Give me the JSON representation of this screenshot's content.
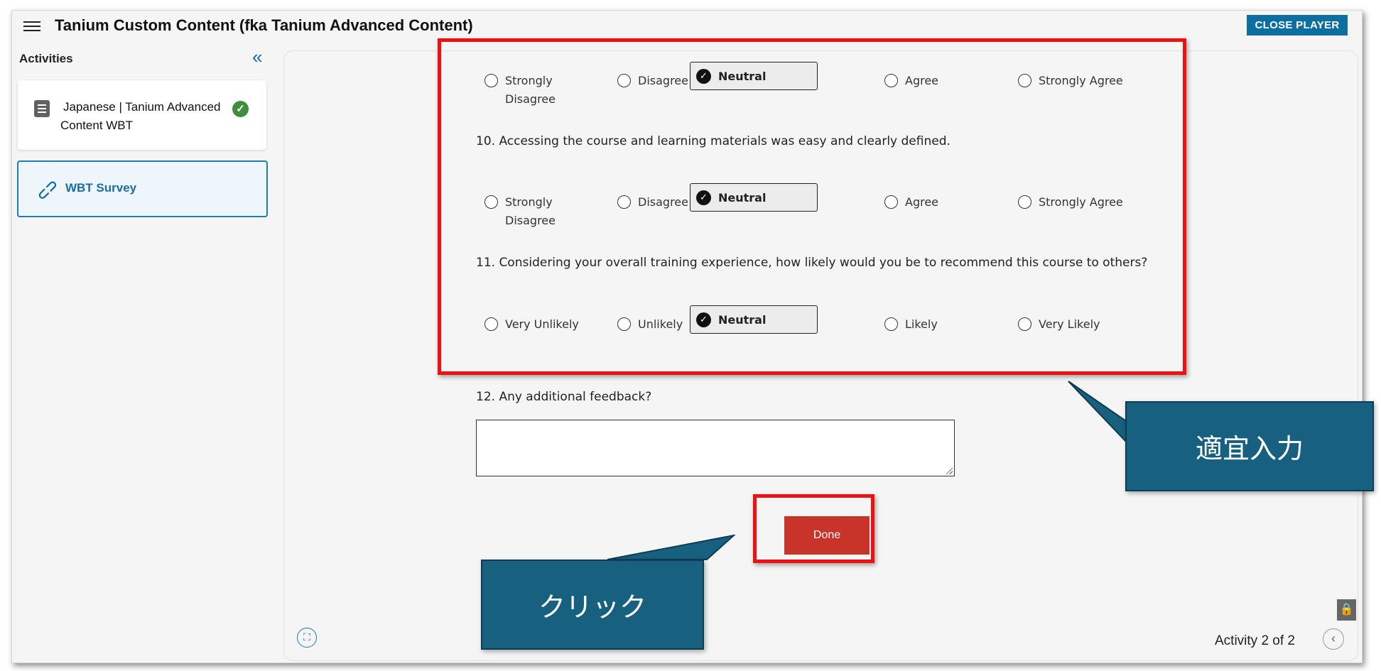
{
  "header": {
    "title": "Tanium Custom Content (fka Tanium Advanced Content)",
    "close_label": "CLOSE PLAYER"
  },
  "sidebar": {
    "heading": "Activities",
    "items": [
      {
        "label": "Japanese | Tanium Advanced Content WBT",
        "icon": "document-icon",
        "status": "completed"
      },
      {
        "label": "WBT Survey",
        "icon": "link-icon",
        "active": true
      }
    ]
  },
  "survey": {
    "q9_options": [
      "Strongly Disagree",
      "Disagree",
      "Neutral",
      "Agree",
      "Strongly Agree"
    ],
    "q10_text": "10. Accessing the course and learning materials was easy and clearly defined.",
    "q10_options": [
      "Strongly Disagree",
      "Disagree",
      "Neutral",
      "Agree",
      "Strongly Agree"
    ],
    "q11_text": "11. Considering your overall training experience, how likely would you be to recommend this course to others?",
    "q11_options": [
      "Very Unlikely",
      "Unlikely",
      "Neutral",
      "Likely",
      "Very Likely"
    ],
    "selected": "Neutral",
    "q12_text": "12. Any additional feedback?",
    "feedback_value": "",
    "done_label": "Done"
  },
  "footer": {
    "activity_counter": "Activity 2 of 2"
  },
  "annotations": {
    "input_callout": "適宜入力",
    "click_callout": "クリック",
    "highlight_color": "#ee1111",
    "callout_color": "#17607f"
  },
  "colors": {
    "accent": "#0d6ea0",
    "done_button": "#c8342a",
    "complete_badge": "#3e8e3e"
  }
}
